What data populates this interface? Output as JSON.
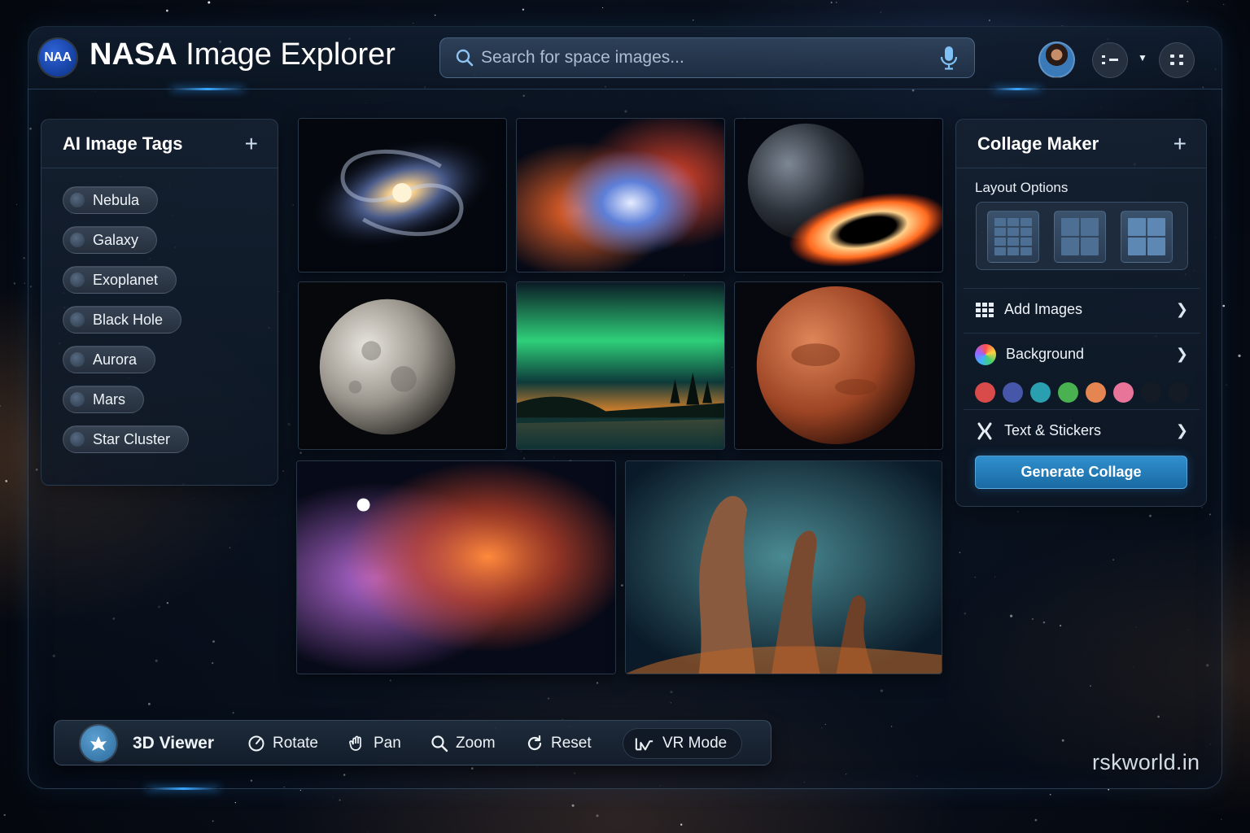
{
  "header": {
    "logo_text": "NAA",
    "title_bold": "NASA",
    "title_rest": " Image Explorer",
    "search_placeholder": "Search for space images..."
  },
  "tags_panel": {
    "title": "AI Image Tags",
    "tags": [
      "Nebula",
      "Galaxy",
      "Exoplanet",
      "Black Hole",
      "Aurora",
      "Mars",
      "Star Cluster"
    ]
  },
  "gallery": {
    "images": [
      {
        "name": "spiral-galaxy-image"
      },
      {
        "name": "nebula-image"
      },
      {
        "name": "exoplanet-black-hole-image"
      },
      {
        "name": "moon-image"
      },
      {
        "name": "aurora-image"
      },
      {
        "name": "mars-image"
      },
      {
        "name": "star-cluster-nebula-image"
      },
      {
        "name": "pillars-of-creation-image"
      }
    ]
  },
  "collage": {
    "title": "Collage Maker",
    "layout_label": "Layout Options",
    "add_images": "Add Images",
    "background": "Background",
    "text_stickers": "Text & Stickers",
    "generate": "Generate Collage",
    "swatches": [
      "#d94b4b",
      "#4656a8",
      "#2a9fb0",
      "#49b14f",
      "#e48552",
      "#e8749a",
      "#151b24",
      "#151b24"
    ]
  },
  "toolbar": {
    "viewer": "3D Viewer",
    "rotate": "Rotate",
    "pan": "Pan",
    "zoom": "Zoom",
    "reset": "Reset",
    "vr": "VR Mode"
  },
  "watermark": "rskworld.in"
}
